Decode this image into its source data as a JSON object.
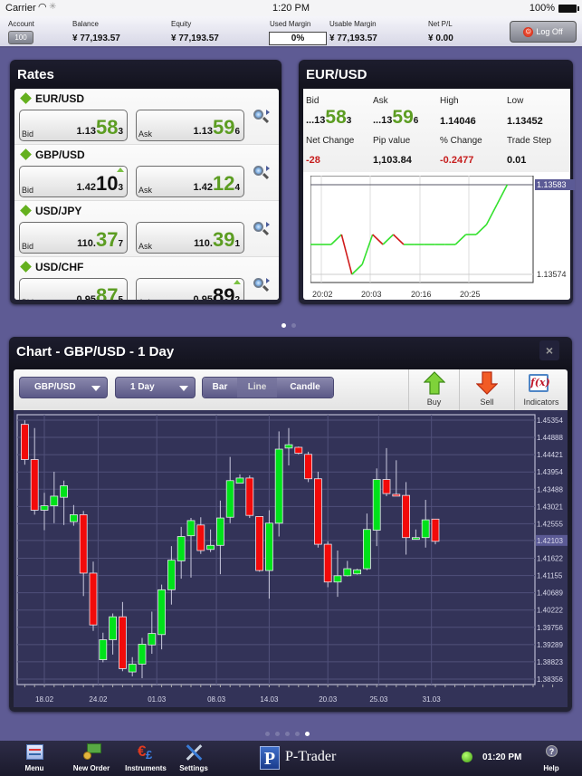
{
  "status_bar": {
    "carrier": "Carrier",
    "time": "1:20 PM",
    "battery": "100%"
  },
  "account_bar": {
    "account_label": "Account",
    "account_value": "100",
    "balance_label": "Balance",
    "balance_value": "¥ 77,193.57",
    "equity_label": "Equity",
    "equity_value": "¥ 77,193.57",
    "used_margin_label": "Used Margin",
    "used_margin_value": "0%",
    "usable_margin_label": "Usable Margin",
    "usable_margin_value": "¥ 77,193.57",
    "net_pl_label": "Net P/L",
    "net_pl_value": "¥ 0.00",
    "logoff_label": "Log Off"
  },
  "rates": {
    "title": "Rates",
    "items": [
      {
        "symbol": "EUR/USD",
        "bid": {
          "label": "Bid",
          "pre": "1.13",
          "big": "58",
          "pip": "3",
          "color": "green",
          "up": false
        },
        "ask": {
          "label": "Ask",
          "pre": "1.13",
          "big": "59",
          "pip": "6",
          "color": "green",
          "up": false
        }
      },
      {
        "symbol": "GBP/USD",
        "bid": {
          "label": "Bid",
          "pre": "1.42",
          "big": "10",
          "pip": "3",
          "color": "black",
          "up": true
        },
        "ask": {
          "label": "Ask",
          "pre": "1.42",
          "big": "12",
          "pip": "4",
          "color": "green",
          "up": false
        }
      },
      {
        "symbol": "USD/JPY",
        "bid": {
          "label": "Bid",
          "pre": "110.",
          "big": "37",
          "pip": "7",
          "color": "green",
          "up": false
        },
        "ask": {
          "label": "Ask",
          "pre": "110.",
          "big": "39",
          "pip": "1",
          "color": "green",
          "up": false
        }
      },
      {
        "symbol": "USD/CHF",
        "bid": {
          "label": "Bid",
          "pre": "0.95",
          "big": "87",
          "pip": "5",
          "color": "green",
          "up": false
        },
        "ask": {
          "label": "Ask",
          "pre": "0.95",
          "big": "89",
          "pip": "2",
          "color": "black",
          "up": true
        }
      }
    ]
  },
  "detail": {
    "title": "EUR/USD",
    "bid_label": "Bid",
    "bid_pre": "...13",
    "bid_big": "58",
    "bid_pip": "3",
    "ask_label": "Ask",
    "ask_pre": "...13",
    "ask_big": "59",
    "ask_pip": "6",
    "high_label": "High",
    "high_value": "1.14046",
    "low_label": "Low",
    "low_value": "1.13452",
    "net_change_label": "Net Change",
    "net_change_value": "-28",
    "pip_value_label": "Pip value",
    "pip_value_value": "1,103.84",
    "pct_change_label": "% Change",
    "pct_change_value": "-0.2477",
    "trade_step_label": "Trade Step",
    "trade_step_value": "0.01",
    "spark": {
      "y_high_label": "1.13583",
      "y_low_label": "1.13574",
      "x_labels": [
        "20:02",
        "20:03",
        "20:16",
        "20:25"
      ],
      "points": [
        1.13577,
        1.13577,
        1.13577,
        1.13578,
        1.13574,
        1.13575,
        1.13578,
        1.13577,
        1.13578,
        1.13577,
        1.13577,
        1.13577,
        1.13577,
        1.13577,
        1.13577,
        1.13578,
        1.13578,
        1.13579,
        1.13581,
        1.13583
      ]
    }
  },
  "pager_top": {
    "count": 2,
    "active": 0
  },
  "chart": {
    "title": "Chart - GBP/USD - 1 Day",
    "close_label": "×",
    "instrument_select": "GBP/USD",
    "period_select": "1 Day",
    "type_options": [
      "Bar",
      "Line",
      "Candle"
    ],
    "type_selected": "Line",
    "buy_label": "Buy",
    "sell_label": "Sell",
    "indicators_label": "Indicators",
    "colors": {
      "up": "#00e21a",
      "down": "#f20a0a"
    }
  },
  "chart_data": {
    "type": "candlestick",
    "title": "Chart - GBP/USD - 1 Day",
    "y_ticks": [
      "1.45354",
      "1.44888",
      "1.44421",
      "1.43954",
      "1.43488",
      "1.43021",
      "1.42555",
      "1.42103",
      "1.41622",
      "1.41155",
      "1.40689",
      "1.40222",
      "1.39756",
      "1.39289",
      "1.38823",
      "1.38356"
    ],
    "current_price_label": "1.42103",
    "ylim": [
      1.38356,
      1.45354
    ],
    "x_labels": [
      "18.02",
      "24.02",
      "01.03",
      "08.03",
      "14.03",
      "20.03",
      "25.03",
      "31.03"
    ],
    "candles": [
      [
        1.4524,
        1.4535,
        1.4415,
        1.4429
      ],
      [
        1.4429,
        1.4514,
        1.428,
        1.4292
      ],
      [
        1.4292,
        1.4339,
        1.4238,
        1.4304
      ],
      [
        1.4304,
        1.4396,
        1.4257,
        1.433
      ],
      [
        1.4327,
        1.4372,
        1.4252,
        1.4358
      ],
      [
        1.4261,
        1.4306,
        1.425,
        1.428
      ],
      [
        1.428,
        1.429,
        1.406,
        1.4122
      ],
      [
        1.4122,
        1.4153,
        1.3966,
        1.3982
      ],
      [
        1.3888,
        1.3961,
        1.3881,
        1.3942
      ],
      [
        1.3942,
        1.4013,
        1.3902,
        1.4004
      ],
      [
        1.4004,
        1.4044,
        1.3857,
        1.3864
      ],
      [
        1.3855,
        1.3895,
        1.3843,
        1.3876
      ],
      [
        1.3876,
        1.3947,
        1.3838,
        1.393
      ],
      [
        1.3928,
        1.4018,
        1.3904,
        1.3959
      ],
      [
        1.3956,
        1.4091,
        1.3916,
        1.4077
      ],
      [
        1.4077,
        1.4195,
        1.4037,
        1.4157
      ],
      [
        1.4155,
        1.4247,
        1.4107,
        1.4221
      ],
      [
        1.4223,
        1.4271,
        1.411,
        1.4264
      ],
      [
        1.4252,
        1.4273,
        1.4174,
        1.4183
      ],
      [
        1.4186,
        1.424,
        1.4179,
        1.4197
      ],
      [
        1.4197,
        1.4318,
        1.4119,
        1.4271
      ],
      [
        1.4273,
        1.4436,
        1.4257,
        1.4372
      ],
      [
        1.4365,
        1.4389,
        1.4365,
        1.4379
      ],
      [
        1.4379,
        1.4386,
        1.4271,
        1.4278
      ],
      [
        1.4275,
        1.4275,
        1.4126,
        1.4129
      ],
      [
        1.4129,
        1.4292,
        1.4053,
        1.4257
      ],
      [
        1.4257,
        1.4505,
        1.4221,
        1.4457
      ],
      [
        1.446,
        1.4514,
        1.4413,
        1.4469
      ],
      [
        1.4462,
        1.4464,
        1.4443,
        1.4446
      ],
      [
        1.4443,
        1.445,
        1.4368,
        1.4377
      ],
      [
        1.4377,
        1.4396,
        1.4191,
        1.42
      ],
      [
        1.42,
        1.4208,
        1.4084,
        1.4098
      ],
      [
        1.4098,
        1.4183,
        1.4058,
        1.4115
      ],
      [
        1.4115,
        1.4155,
        1.4113,
        1.4134
      ],
      [
        1.412,
        1.4134,
        1.4118,
        1.4131
      ],
      [
        1.4134,
        1.4283,
        1.413,
        1.424
      ],
      [
        1.4238,
        1.4405,
        1.4195,
        1.4375
      ],
      [
        1.4375,
        1.446,
        1.433,
        1.4337
      ],
      [
        1.4335,
        1.4427,
        1.433,
        1.4332
      ],
      [
        1.4332,
        1.4368,
        1.4172,
        1.4218
      ],
      [
        1.4216,
        1.424,
        1.4213,
        1.4218
      ],
      [
        1.4218,
        1.432,
        1.4191,
        1.4266
      ],
      [
        1.4268,
        1.4268,
        1.42,
        1.4208
      ]
    ],
    "candle_format": [
      "open",
      "high",
      "low",
      "close"
    ],
    "grid": true
  },
  "pager_bottom": {
    "count": 5,
    "active": 4
  },
  "bottom_bar": {
    "menu_label": "Menu",
    "new_order_label": "New Order",
    "instruments_label": "Instruments",
    "settings_label": "Settings",
    "brand": "P-Trader",
    "brand_letter": "P",
    "clock": "01:20 PM",
    "help_label": "Help"
  }
}
